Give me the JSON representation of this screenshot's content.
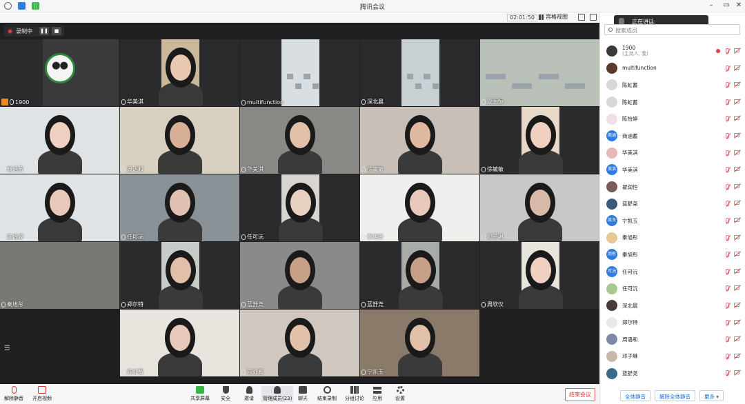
{
  "window": {
    "title": "腾讯会议"
  },
  "toolbar": {
    "timer": "02:01:50",
    "grid_view": "宫格视图"
  },
  "recording": {
    "label": "录制中"
  },
  "speaking": {
    "label": "正在讲话:"
  },
  "tiles": [
    {
      "name": "1900",
      "host": true
    },
    {
      "name": "华美淇"
    },
    {
      "name": "multifunction"
    },
    {
      "name": "深北晨"
    },
    {
      "name": "翟润恒"
    },
    {
      "name": "商涵蓄"
    },
    {
      "name": "周语和"
    },
    {
      "name": "华美淇"
    },
    {
      "name": "徐毓敏"
    },
    {
      "name": "徐毓敏"
    },
    {
      "name": "陈怡婷"
    },
    {
      "name": "任可沅"
    },
    {
      "name": "任可沅"
    },
    {
      "name": "秦旭彤"
    },
    {
      "name": "邓子琳"
    },
    {
      "name": "秦旭彤"
    },
    {
      "name": "郑尔特"
    },
    {
      "name": "蓝舒尧"
    },
    {
      "name": "蓝舒尧"
    },
    {
      "name": "周欣仪"
    },
    {
      "name": "陈虹蓄"
    },
    {
      "name": "陈虹蓄"
    },
    {
      "name": "宁凯玉"
    }
  ],
  "sidebar": {
    "search_placeholder": "搜索成员",
    "members": [
      {
        "name": "1900",
        "sub": "(主持人, 我)",
        "avatar": "",
        "color": "#3a3a3a",
        "recording": true
      },
      {
        "name": "multifunction",
        "avatar": "",
        "color": "#5a3a2a"
      },
      {
        "name": "陈虹蓄",
        "avatar": "",
        "color": "#d8d8d8"
      },
      {
        "name": "陈虹蓄",
        "avatar": "",
        "color": "#d8d8d8"
      },
      {
        "name": "陈怡婷",
        "avatar": "",
        "color": "#f0e0e6"
      },
      {
        "name": "商涵蓄",
        "avatar": "商涵",
        "color": "#2f7de1"
      },
      {
        "name": "华美淇",
        "avatar": "",
        "color": "#e8b8b8"
      },
      {
        "name": "华美淇",
        "avatar": "美淇",
        "color": "#2f7de1"
      },
      {
        "name": "翟润恒",
        "avatar": "",
        "color": "#7a5a5a"
      },
      {
        "name": "蓝舒尧",
        "avatar": "",
        "color": "#3a5a7a"
      },
      {
        "name": "宁凯玉",
        "avatar": "凯玉",
        "color": "#2f7de1"
      },
      {
        "name": "秦旭彤",
        "avatar": "",
        "color": "#e8c890"
      },
      {
        "name": "秦旭彤",
        "avatar": "旭彤",
        "color": "#2f7de1"
      },
      {
        "name": "任可沅",
        "avatar": "可沅",
        "color": "#2f7de1"
      },
      {
        "name": "任可沅",
        "avatar": "",
        "color": "#a8c890"
      },
      {
        "name": "深北晨",
        "avatar": "",
        "color": "#4a3a3a"
      },
      {
        "name": "郑尔特",
        "avatar": "",
        "color": "#e8e8e8"
      },
      {
        "name": "周语和",
        "avatar": "",
        "color": "#7a8aa8"
      },
      {
        "name": "邓子琳",
        "avatar": "",
        "color": "#c8b8a8"
      },
      {
        "name": "蓝舒尧",
        "avatar": "",
        "color": "#3a6a8a"
      }
    ],
    "buttons": {
      "mute_all": "全体静音",
      "unmute_all": "解除全体静音",
      "more": "更多 ▾"
    }
  },
  "bottom_bar": {
    "unmute": "解除静音",
    "start_video": "开启视频",
    "share_screen": "共享屏幕",
    "security": "安全",
    "invite": "邀请",
    "manage_members": "管理成员(23)",
    "chat": "聊天",
    "record": "结束录制",
    "breakout": "分组讨论",
    "apps": "应用",
    "settings": "设置",
    "end_meeting": "结束会议"
  }
}
